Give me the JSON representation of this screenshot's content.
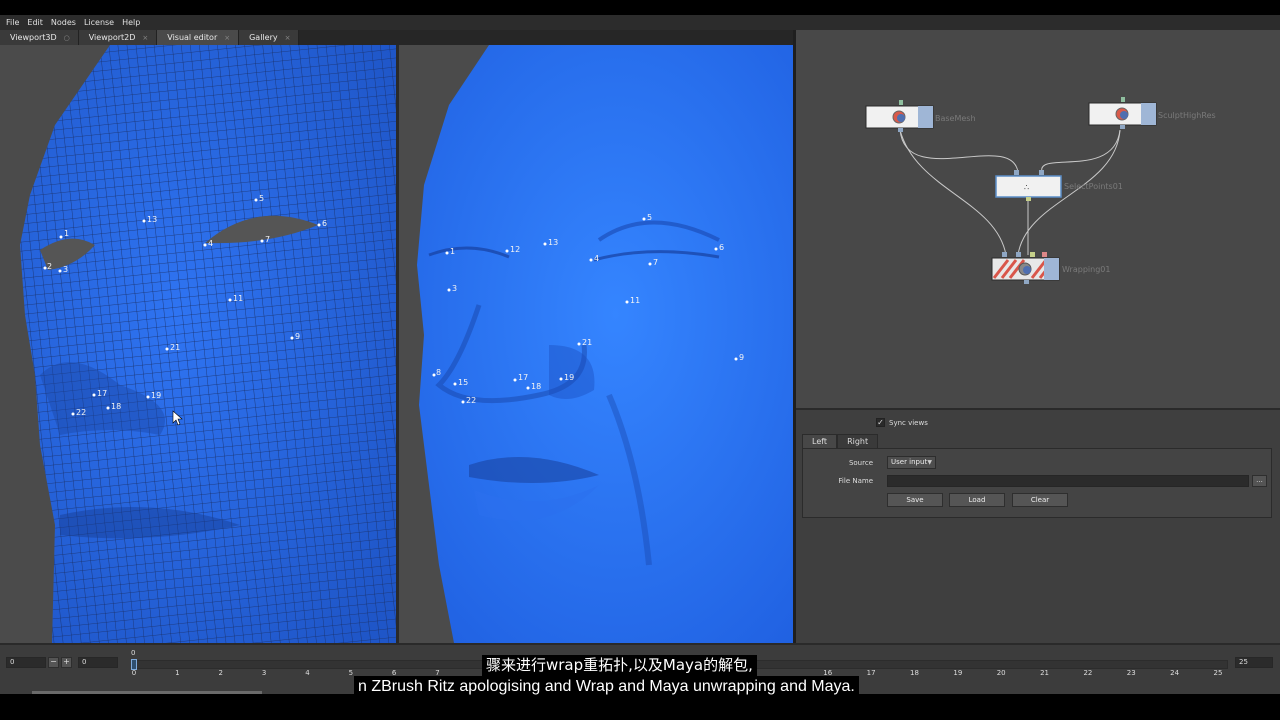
{
  "menu": [
    "File",
    "Edit",
    "Nodes",
    "License",
    "Help"
  ],
  "tabs": [
    {
      "label": "Viewport3D",
      "close": "○"
    },
    {
      "label": "Viewport2D",
      "close": "×"
    },
    {
      "label": "Visual editor",
      "close": "×"
    },
    {
      "label": "Gallery",
      "close": "×"
    }
  ],
  "left_points": [
    "1",
    "2",
    "3",
    "4",
    "5",
    "6",
    "7",
    "9",
    "11",
    "13",
    "17",
    "18",
    "19",
    "21",
    "22"
  ],
  "right_points": [
    "1",
    "12",
    "13",
    "5",
    "4",
    "7",
    "6",
    "3",
    "11",
    "21",
    "9",
    "8",
    "15",
    "17",
    "18",
    "19",
    "22"
  ],
  "nodes": {
    "base": "BaseMesh",
    "sculpt": "SculptHighRes",
    "select": "SelectPoints01",
    "wrap": "Wrapping01"
  },
  "props": {
    "sync_label": "Sync views",
    "sync_checked": "✓",
    "tab_left": "Left",
    "tab_right": "Right",
    "source_label": "Source",
    "source_value": "User input",
    "filename_label": "File Name",
    "browse": "...",
    "save": "Save",
    "load": "Load",
    "clear": "Clear"
  },
  "timeline": {
    "start_value": "0",
    "minus": "−",
    "plus": "+",
    "current_value": "0",
    "end_value": "25",
    "current_marker": "0",
    "ticks": [
      "0",
      "1",
      "2",
      "3",
      "4",
      "5",
      "6",
      "7",
      "16",
      "17",
      "18",
      "19",
      "20",
      "21",
      "22",
      "23",
      "24",
      "25"
    ]
  },
  "subtitles": {
    "line1": "骤来进行wrap重拓扑,以及Maya的解包,",
    "line2": "n ZBrush  Ritz apologising and Wrap and Maya unwrapping and Maya."
  }
}
